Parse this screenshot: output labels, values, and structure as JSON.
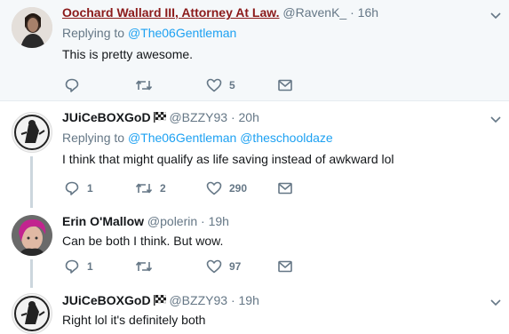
{
  "tweets": [
    {
      "name": "Oochard Wallard III, Attorney At Law.",
      "handle": "@RavenK_",
      "time": "16h",
      "replying_prefix": "Replying to",
      "replying_to": "@The06Gentleman",
      "replying_to_2": "",
      "text": "This is pretty awesome.",
      "reply_count": "",
      "retweet_count": "",
      "like_count": "5"
    },
    {
      "name": "JUiCeBOXGoD",
      "handle": "@BZZY93",
      "time": "20h",
      "replying_prefix": "Replying to",
      "replying_to": "@The06Gentleman",
      "replying_to_2": "@theschooldaze",
      "text": "I think that might qualify as life saving instead of awkward lol",
      "reply_count": "1",
      "retweet_count": "2",
      "like_count": "290"
    },
    {
      "name": "Erin O'Mallow",
      "handle": "@polerin",
      "time": "19h",
      "text": "Can be both I think.  But wow.",
      "reply_count": "1",
      "retweet_count": "",
      "like_count": "97"
    },
    {
      "name": "JUiCeBOXGoD",
      "handle": "@BZZY93",
      "time": "19h",
      "text": "Right lol it's definitely both"
    }
  ],
  "separator": "·",
  "icons": {
    "reply": "reply-icon",
    "retweet": "retweet-icon",
    "like": "heart-icon",
    "dm": "envelope-icon",
    "caret": "chevron-down-icon",
    "badge": "checkered-flag-icon"
  },
  "colors": {
    "highlight_bg": "#f5f8fa",
    "link": "#1da1f2",
    "muted": "#657786",
    "thread": "#ccd6dd",
    "linked_name": "#8b1a1a"
  }
}
